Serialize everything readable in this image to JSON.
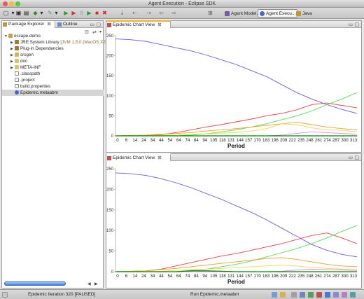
{
  "window": {
    "title": "Agent Execution - Eclipse SDK"
  },
  "toolbar": {
    "icons": [
      "new-file-icon",
      "save-icon",
      "print-icon",
      "new-wizard-icon",
      "step-icon",
      "run-icon",
      "run-step-icon",
      "pause-icon",
      "play-icon",
      "stop-icon",
      "close-icon",
      "nav-icon",
      "back-icon",
      "forward-icon",
      "history-icon"
    ],
    "perspectives": [
      {
        "label": "Agent Model...",
        "active": false
      },
      {
        "label": "Agent Execu...",
        "active": true
      },
      {
        "label": "Java",
        "active": false
      }
    ]
  },
  "left_pane": {
    "tabs": [
      {
        "label": "Package Explorer",
        "close": "⊠",
        "selected": true
      },
      {
        "label": "Outline",
        "selected": false
      }
    ],
    "tree": [
      {
        "label": "escape.demo",
        "depth": 0,
        "expanded": true,
        "icon": "project-icon"
      },
      {
        "label": "JRE System Library",
        "suffix": "[JVM 1.5.0 (MacOS X Defa",
        "depth": 1,
        "expanded": false,
        "icon": "library-icon"
      },
      {
        "label": "Plug-in Dependencies",
        "depth": 1,
        "expanded": false,
        "icon": "library-icon"
      },
      {
        "label": "srcgen",
        "depth": 1,
        "expanded": false,
        "icon": "source-folder-icon"
      },
      {
        "label": "doc",
        "depth": 1,
        "expanded": false,
        "icon": "folder-icon"
      },
      {
        "label": "META-INF",
        "depth": 1,
        "expanded": false,
        "icon": "folder-icon"
      },
      {
        "label": ".classpath",
        "depth": 1,
        "icon": "file-icon"
      },
      {
        "label": ".project",
        "depth": 1,
        "icon": "file-icon"
      },
      {
        "label": "build.properties",
        "depth": 1,
        "icon": "file-icon"
      },
      {
        "label": "Epidemic.metaabm",
        "depth": 1,
        "icon": "model-icon",
        "selected": true
      }
    ]
  },
  "views": [
    {
      "tab": "Epidemic Chart View",
      "close": "⊠"
    },
    {
      "tab": "Epidemic Chart View",
      "close": "⊠"
    }
  ],
  "status": {
    "left": "Epidemic Iteration 320 [PAUSED]",
    "right": "Run Epidemic.metaabm"
  },
  "chart_data": [
    {
      "type": "line",
      "xlabel": "Period",
      "categories": [
        "0",
        "6",
        "14",
        "24",
        "34",
        "44",
        "54",
        "64",
        "74",
        "84",
        "94",
        "105",
        "118",
        "131",
        "144",
        "157",
        "170",
        "183",
        "196",
        "209",
        "222",
        "235",
        "248",
        "261",
        "274",
        "287",
        "300",
        "313"
      ],
      "ylim": [
        0,
        250
      ],
      "yticks": [
        0,
        50,
        100,
        150,
        200,
        250
      ],
      "x_max": 320,
      "series": [
        {
          "color": "#6a5cf0",
          "points": [
            [
              0,
              242
            ],
            [
              20,
              240
            ],
            [
              40,
              236
            ],
            [
              60,
              228
            ],
            [
              80,
              220
            ],
            [
              100,
              212
            ],
            [
              120,
              202
            ],
            [
              140,
              190
            ],
            [
              160,
              178
            ],
            [
              180,
              163
            ],
            [
              200,
              148
            ],
            [
              220,
              128
            ],
            [
              240,
              108
            ],
            [
              260,
              92
            ],
            [
              280,
              78
            ],
            [
              300,
              66
            ],
            [
              320,
              56
            ]
          ]
        },
        {
          "color": "#ee4444",
          "points": [
            [
              0,
              0
            ],
            [
              40,
              1
            ],
            [
              60,
              3
            ],
            [
              80,
              8
            ],
            [
              100,
              15
            ],
            [
              120,
              22
            ],
            [
              140,
              28
            ],
            [
              160,
              35
            ],
            [
              180,
              42
            ],
            [
              200,
              50
            ],
            [
              220,
              56
            ],
            [
              240,
              65
            ],
            [
              260,
              78
            ],
            [
              280,
              82
            ],
            [
              300,
              76
            ],
            [
              320,
              70
            ]
          ]
        },
        {
          "color": "#55dd55",
          "points": [
            [
              0,
              0
            ],
            [
              80,
              0
            ],
            [
              100,
              2
            ],
            [
              120,
              5
            ],
            [
              140,
              10
            ],
            [
              160,
              15
            ],
            [
              180,
              22
            ],
            [
              200,
              30
            ],
            [
              220,
              40
            ],
            [
              240,
              50
            ],
            [
              260,
              62
            ],
            [
              280,
              78
            ],
            [
              300,
              92
            ],
            [
              320,
              108
            ]
          ]
        },
        {
          "color": "#f0a030",
          "points": [
            [
              0,
              0
            ],
            [
              40,
              2
            ],
            [
              60,
              4
            ],
            [
              80,
              6
            ],
            [
              100,
              8
            ],
            [
              120,
              12
            ],
            [
              140,
              15
            ],
            [
              160,
              18
            ],
            [
              180,
              22
            ],
            [
              200,
              26
            ],
            [
              220,
              30
            ],
            [
              240,
              34
            ],
            [
              260,
              28
            ],
            [
              280,
              22
            ],
            [
              300,
              18
            ],
            [
              320,
              15
            ]
          ]
        },
        {
          "color": "#f5d45a",
          "points": [
            [
              0,
              0
            ],
            [
              60,
              1
            ],
            [
              80,
              2
            ],
            [
              100,
              4
            ],
            [
              120,
              5
            ],
            [
              140,
              7
            ],
            [
              160,
              8
            ],
            [
              180,
              12
            ],
            [
              200,
              18
            ],
            [
              220,
              30
            ],
            [
              240,
              28
            ],
            [
              260,
              20
            ],
            [
              280,
              15
            ],
            [
              300,
              14
            ],
            [
              320,
              10
            ]
          ]
        },
        {
          "color": "#ff77ff",
          "points": [
            [
              0,
              0
            ],
            [
              200,
              0
            ],
            [
              220,
              2
            ],
            [
              240,
              6
            ],
            [
              260,
              10
            ],
            [
              280,
              8
            ],
            [
              300,
              6
            ],
            [
              320,
              4
            ]
          ]
        },
        {
          "color": "#008800",
          "points": [
            [
              0,
              0
            ],
            [
              320,
              0
            ]
          ]
        }
      ]
    },
    {
      "type": "line",
      "xlabel": "Period",
      "categories": [
        "0",
        "6",
        "14",
        "24",
        "34",
        "44",
        "54",
        "64",
        "74",
        "84",
        "94",
        "105",
        "118",
        "131",
        "144",
        "157",
        "170",
        "183",
        "196",
        "209",
        "222",
        "235",
        "248",
        "261",
        "274",
        "287",
        "300",
        "313"
      ],
      "ylim": [
        0,
        250
      ],
      "yticks": [
        0,
        50,
        100,
        150,
        200,
        250
      ],
      "x_max": 320,
      "series": [
        {
          "color": "#6a5cf0",
          "points": [
            [
              0,
              240
            ],
            [
              20,
              238
            ],
            [
              40,
              234
            ],
            [
              60,
              226
            ],
            [
              80,
              216
            ],
            [
              100,
              204
            ],
            [
              120,
              190
            ],
            [
              140,
              176
            ],
            [
              160,
              160
            ],
            [
              180,
              144
            ],
            [
              200,
              126
            ],
            [
              220,
              106
            ],
            [
              240,
              86
            ],
            [
              260,
              66
            ],
            [
              280,
              52
            ],
            [
              300,
              42
            ],
            [
              320,
              36
            ]
          ]
        },
        {
          "color": "#ee4444",
          "points": [
            [
              0,
              0
            ],
            [
              40,
              2
            ],
            [
              60,
              6
            ],
            [
              80,
              14
            ],
            [
              100,
              22
            ],
            [
              120,
              30
            ],
            [
              140,
              38
            ],
            [
              160,
              44
            ],
            [
              180,
              52
            ],
            [
              200,
              60
            ],
            [
              220,
              68
            ],
            [
              240,
              78
            ],
            [
              260,
              88
            ],
            [
              280,
              94
            ],
            [
              300,
              82
            ],
            [
              320,
              68
            ]
          ]
        },
        {
          "color": "#55dd55",
          "points": [
            [
              0,
              0
            ],
            [
              80,
              0
            ],
            [
              100,
              3
            ],
            [
              120,
              6
            ],
            [
              140,
              12
            ],
            [
              160,
              18
            ],
            [
              180,
              26
            ],
            [
              200,
              36
            ],
            [
              220,
              46
            ],
            [
              240,
              56
            ],
            [
              260,
              68
            ],
            [
              280,
              82
            ],
            [
              300,
              98
            ],
            [
              320,
              112
            ]
          ]
        },
        {
          "color": "#f0a030",
          "points": [
            [
              0,
              0
            ],
            [
              40,
              2
            ],
            [
              60,
              5
            ],
            [
              80,
              8
            ],
            [
              100,
              12
            ],
            [
              120,
              16
            ],
            [
              140,
              20
            ],
            [
              160,
              24
            ],
            [
              180,
              28
            ],
            [
              200,
              32
            ],
            [
              220,
              34
            ],
            [
              240,
              30
            ],
            [
              260,
              24
            ],
            [
              280,
              18
            ],
            [
              300,
              14
            ],
            [
              320,
              12
            ]
          ]
        },
        {
          "color": "#f5d45a",
          "points": [
            [
              0,
              0
            ],
            [
              60,
              1
            ],
            [
              80,
              3
            ],
            [
              100,
              5
            ],
            [
              120,
              6
            ],
            [
              140,
              8
            ],
            [
              160,
              10
            ],
            [
              180,
              12
            ],
            [
              200,
              14
            ],
            [
              220,
              16
            ],
            [
              240,
              14
            ],
            [
              260,
              10
            ],
            [
              280,
              8
            ],
            [
              300,
              6
            ],
            [
              320,
              5
            ]
          ]
        },
        {
          "color": "#ff77ff",
          "points": [
            [
              0,
              0
            ],
            [
              200,
              0
            ],
            [
              220,
              1
            ],
            [
              240,
              4
            ],
            [
              260,
              6
            ],
            [
              280,
              5
            ],
            [
              300,
              4
            ],
            [
              320,
              3
            ]
          ]
        },
        {
          "color": "#008800",
          "points": [
            [
              0,
              0
            ],
            [
              80,
              0
            ],
            [
              100,
              2
            ],
            [
              120,
              2
            ],
            [
              140,
              1
            ],
            [
              160,
              0
            ],
            [
              320,
              0
            ]
          ]
        }
      ]
    }
  ]
}
